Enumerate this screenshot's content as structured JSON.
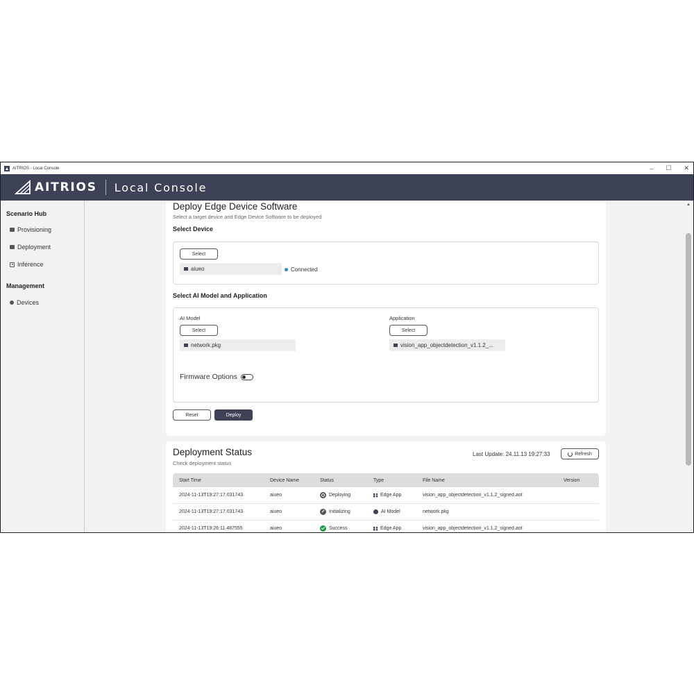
{
  "window": {
    "title": "AITRIOS - Local Console",
    "controls": [
      "–",
      "☐",
      "✕"
    ]
  },
  "header": {
    "brand": "AITRIOS",
    "product": "Local Console"
  },
  "sidebar": {
    "sections": [
      {
        "label": "Scenario Hub",
        "items": [
          {
            "label": "Provisioning",
            "icon": "card-icon"
          },
          {
            "label": "Deployment",
            "icon": "card-icon"
          },
          {
            "label": "Inference",
            "icon": "target-icon"
          }
        ]
      },
      {
        "label": "Management",
        "items": [
          {
            "label": "Devices",
            "icon": "gear-icon"
          }
        ]
      }
    ]
  },
  "deploy": {
    "title": "Deploy Edge Device Software",
    "subtitle": "Select a target device and Edge Device Software to be deployed",
    "select_device_heading": "Select Device",
    "select_label": "Select",
    "device_value": "aiueo",
    "connection_status": "Connected",
    "model_app_heading": "Select AI Model and Application",
    "ai_model_label": "AI Model",
    "ai_model_value": "network.pkg",
    "application_label": "Application",
    "application_value": "vision_app_objectdetection_v1.1.2_...",
    "firmware_options_label": "Firmware Options",
    "firmware_options_enabled": false,
    "reset_label": "Reset",
    "deploy_label": "Deploy"
  },
  "status": {
    "title": "Deployment Status",
    "subtitle": "Check deployment status",
    "last_update": "Last Update: 24.11.13 19:27:33",
    "refresh_label": "Refresh",
    "columns": [
      "Start Time",
      "Device Name",
      "Status",
      "Type",
      "File Name",
      "Version"
    ],
    "rows": [
      {
        "start": "2024-11-13T19:27:17.031743",
        "device": "aiueo",
        "status": "Deploying",
        "status_icon": "deploying",
        "type": "Edge App",
        "type_icon": "grid-icon",
        "file": "vision_app_objectdetection_v1.1.2_signed.aot",
        "version": ""
      },
      {
        "start": "2024-11-13T19:27:17.031743",
        "device": "aiueo",
        "status": "Initializing",
        "status_icon": "init",
        "type": "AI Model",
        "type_icon": "model-icon",
        "file": "network.pkg",
        "version": ""
      },
      {
        "start": "2024-11-13T19:26:11.487555",
        "device": "aiueo",
        "status": "Success",
        "status_icon": "success",
        "type": "Edge App",
        "type_icon": "grid-icon",
        "file": "vision_app_objectdetection_v1.1.2_signed.aot",
        "version": ""
      }
    ]
  },
  "colors": {
    "header_bg": "#3d4257",
    "accent_dark": "#3d4257",
    "connected_dot": "#2e86de",
    "success": "#1e9e3e"
  }
}
